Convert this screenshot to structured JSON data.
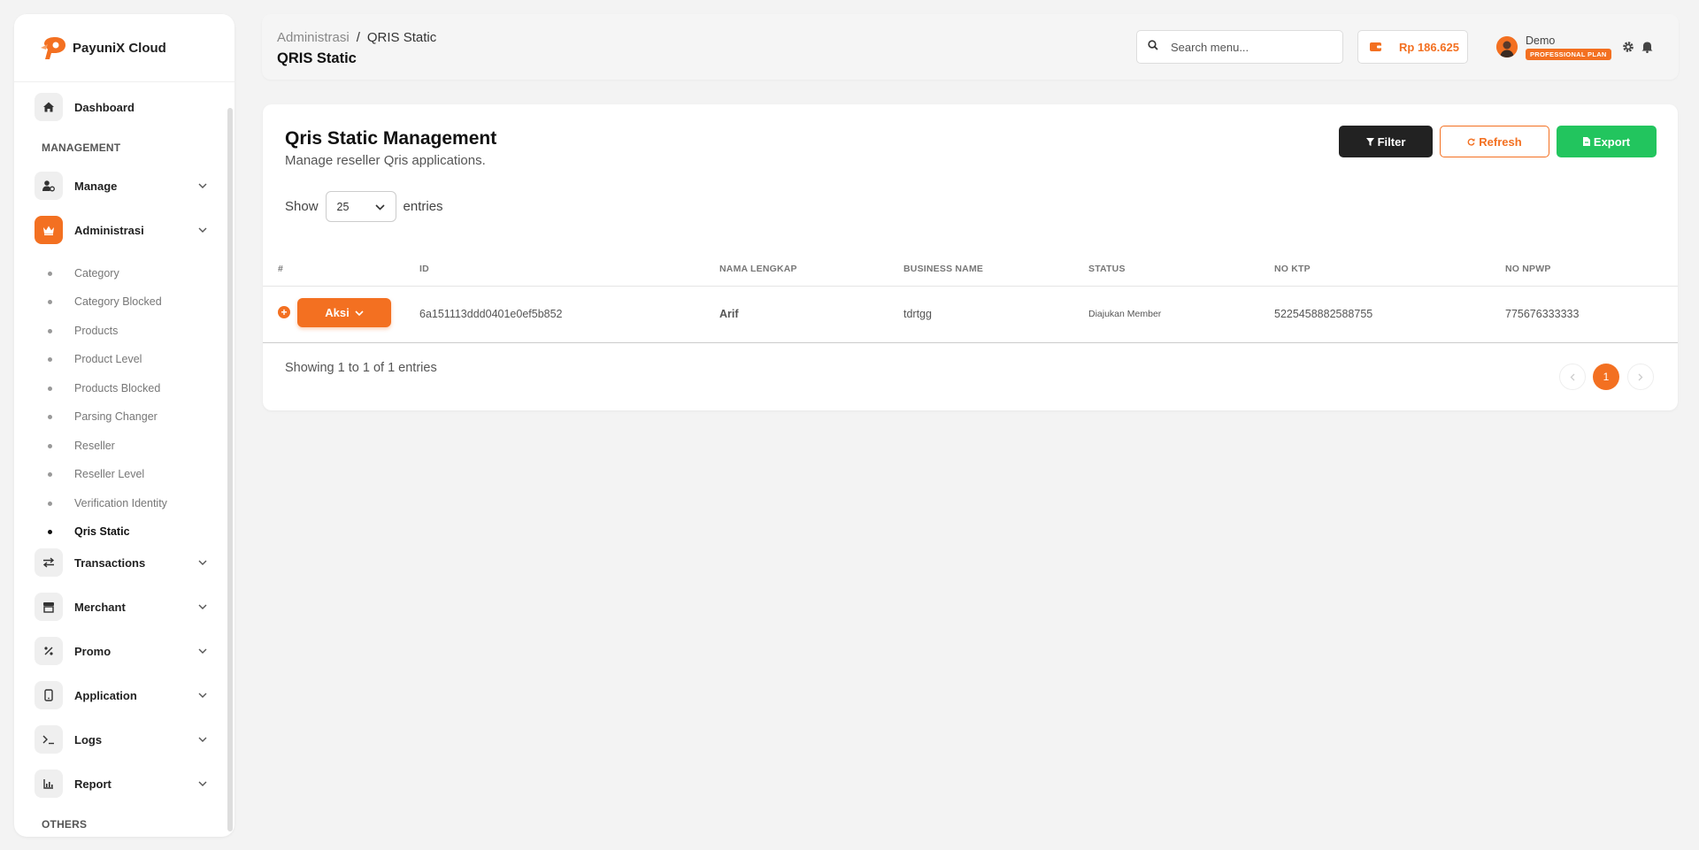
{
  "brand": {
    "name": "PayuniX Cloud"
  },
  "sidebar": {
    "dashboard": "Dashboard",
    "section_management": "MANAGEMENT",
    "manage": "Manage",
    "administrasi": "Administrasi",
    "sub_items": [
      "Category",
      "Category Blocked",
      "Products",
      "Product Level",
      "Products Blocked",
      "Parsing Changer",
      "Reseller",
      "Reseller Level",
      "Verification Identity",
      "Qris Static"
    ],
    "transactions": "Transactions",
    "merchant": "Merchant",
    "promo": "Promo",
    "application": "Application",
    "logs": "Logs",
    "report": "Report",
    "section_others": "OTHERS"
  },
  "header": {
    "breadcrumb_parent": "Administrasi",
    "breadcrumb_sep": "/",
    "breadcrumb_current": "QRIS Static",
    "page_title": "QRIS Static",
    "search_placeholder": "Search menu...",
    "balance": "Rp 186.625",
    "user_name": "Demo",
    "plan": "PROFESSIONAL PLAN"
  },
  "main": {
    "title": "Qris Static Management",
    "subtitle": "Manage reseller Qris applications.",
    "filter_label": "Filter",
    "refresh_label": "Refresh",
    "export_label": "Export",
    "show_label": "Show",
    "entries_value": "25",
    "entries_label": "entries",
    "columns": [
      "#",
      "ID",
      "NAMA LENGKAP",
      "BUSINESS NAME",
      "STATUS",
      "NO KTP",
      "NO NPWP"
    ],
    "rows": [
      {
        "action": "Aksi",
        "id": "6a151113ddd0401e0ef5b852",
        "nama": "Arif",
        "business": "tdrtgg",
        "status": "Diajukan Member",
        "ktp": "5225458882588755",
        "npwp": "775676333333"
      }
    ],
    "showing": "Showing 1 to 1 of 1 entries",
    "current_page": "1"
  },
  "colors": {
    "accent": "#f37021",
    "export": "#22c55e",
    "filter": "#222222"
  }
}
